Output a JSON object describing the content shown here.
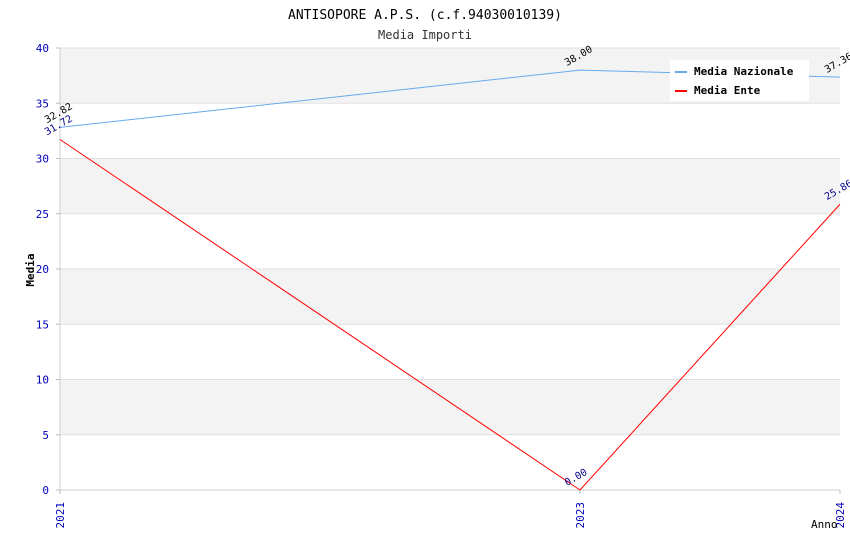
{
  "chart_data": {
    "type": "line",
    "title": "ANTISOPORE A.P.S. (c.f.94030010139)",
    "subtitle": "Media Importi",
    "xlabel": "Anno",
    "ylabel": "Media",
    "x": [
      "2021",
      "2023",
      "2024"
    ],
    "ylim": [
      0,
      40
    ],
    "yticks": [
      0,
      5,
      10,
      15,
      20,
      25,
      30,
      35,
      40
    ],
    "grid": true,
    "legend_position": "top-right",
    "series": [
      {
        "name": "Media Nazionale",
        "color": "#66aaee",
        "label_color": "#000000",
        "values": [
          32.82,
          38.0,
          37.36
        ],
        "labels": [
          "32.82",
          "38.00",
          "37.36"
        ]
      },
      {
        "name": "Media Ente",
        "color": "#ff0000",
        "label_color": "#000088",
        "values": [
          31.72,
          0.0,
          25.86
        ],
        "labels": [
          "31.72",
          "0.00",
          "25.86"
        ]
      }
    ]
  }
}
